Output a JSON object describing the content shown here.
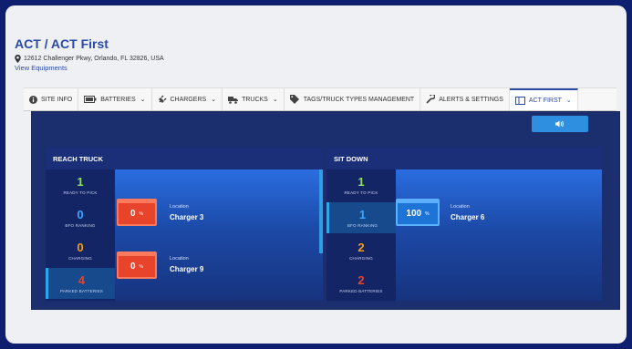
{
  "header": {
    "title": "ACT / ACT First",
    "address": "12612 Challenger Pkwy, Orlando, FL 32826, USA",
    "view_link": "View Equipments"
  },
  "tabs": [
    {
      "label": "SITE INFO",
      "icon": "info-icon"
    },
    {
      "label": "BATTERIES",
      "icon": "battery-icon"
    },
    {
      "label": "CHARGERS",
      "icon": "plug-icon"
    },
    {
      "label": "TRUCKS",
      "icon": "truck-icon"
    },
    {
      "label": "TAGS/TRUCK TYPES MANAGEMENT",
      "icon": "tag-icon"
    },
    {
      "label": "ALERTS & SETTINGS",
      "icon": "wrench-icon"
    },
    {
      "label": "ACT FIRST",
      "icon": "columns-icon"
    }
  ],
  "groups": {
    "reach": {
      "title": "REACH TRUCK",
      "stats": [
        {
          "value": "1",
          "label": "READY TO PICK"
        },
        {
          "value": "0",
          "label": "BFO RANKING"
        },
        {
          "value": "0",
          "label": "CHARGING"
        },
        {
          "value": "4",
          "label": "PARKED BATTERIES"
        }
      ],
      "chargers": [
        {
          "percent": "0",
          "unit": "%",
          "location_label": "Location",
          "location": "Charger 3"
        },
        {
          "percent": "0",
          "unit": "%",
          "location_label": "Location",
          "location": "Charger 9"
        }
      ]
    },
    "sit": {
      "title": "SIT DOWN",
      "stats": [
        {
          "value": "1",
          "label": "READY TO PICK"
        },
        {
          "value": "1",
          "label": "BFO RANKING"
        },
        {
          "value": "2",
          "label": "CHARGING"
        },
        {
          "value": "2",
          "label": "PARKED BATTERIES"
        }
      ],
      "chargers": [
        {
          "percent": "100",
          "unit": "%",
          "location_label": "Location",
          "location": "Charger 6"
        }
      ]
    }
  },
  "colors": {
    "page_bg": "#0e1f6f",
    "accent": "#2a4aa8",
    "ready": "#8fe05e",
    "ranking": "#37a7ff",
    "charging": "#f39c12",
    "parked": "#e8432b"
  }
}
